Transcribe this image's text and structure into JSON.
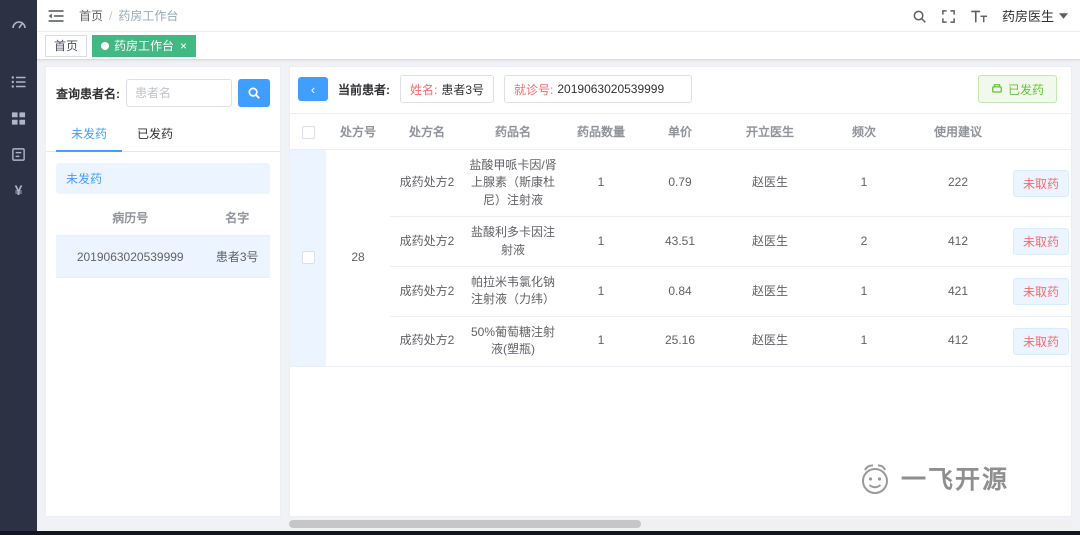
{
  "colors": {
    "accent_blue": "#409eff",
    "accent_green": "#42b983",
    "danger_red": "#f56c6c",
    "sidebar_bg": "#2c3244",
    "row_highlight": "#ecf5ff"
  },
  "sidebar": {
    "icons": [
      "dashboard-icon",
      "workbench-icon",
      "grid-icon",
      "form-icon",
      "money-icon"
    ]
  },
  "header": {
    "breadcrumb": {
      "home": "首页",
      "separator": "/",
      "current": "药房工作台"
    },
    "user_name": "药房医生"
  },
  "tags": {
    "home": "首页",
    "active": "药房工作台",
    "close": "×"
  },
  "left_panel": {
    "search_label": "查询患者名:",
    "search_placeholder": "患者名",
    "tab_undispensed": "未发药",
    "tab_dispensed": "已发药",
    "banner": "未发药",
    "columns": {
      "record_no": "病历号",
      "name": "名字"
    },
    "patients": [
      {
        "record_no": "2019063020539999",
        "name": "患者3号"
      }
    ]
  },
  "right_panel": {
    "back_button": "‹",
    "current_patient_label": "当前患者:",
    "name_label": "姓名:",
    "name_value": "患者3号",
    "visit_label": "就诊号:",
    "visit_value": "2019063020539999",
    "dispense_button": "已发药",
    "table": {
      "headers": [
        "处方号",
        "处方名",
        "药品名",
        "药品数量",
        "单价",
        "开立医生",
        "频次",
        "使用建议",
        ""
      ],
      "prescription_no": "28",
      "rows": [
        {
          "rx_name": "成药处方2",
          "drug": "盐酸甲哌卡因/肾上腺素（斯康杜尼）注射液",
          "qty": "1",
          "price": "0.79",
          "doctor": "赵医生",
          "freq": "1",
          "advice": "222",
          "action": "未取药"
        },
        {
          "rx_name": "成药处方2",
          "drug": "盐酸利多卡因注射液",
          "qty": "1",
          "price": "43.51",
          "doctor": "赵医生",
          "freq": "2",
          "advice": "412",
          "action": "未取药"
        },
        {
          "rx_name": "成药处方2",
          "drug": "帕拉米韦氯化钠注射液（力纬）",
          "qty": "1",
          "price": "0.84",
          "doctor": "赵医生",
          "freq": "1",
          "advice": "421",
          "action": "未取药"
        },
        {
          "rx_name": "成药处方2",
          "drug": "50%葡萄糖注射液(塑瓶)",
          "qty": "1",
          "price": "25.16",
          "doctor": "赵医生",
          "freq": "1",
          "advice": "412",
          "action": "未取药"
        }
      ]
    }
  },
  "watermark": "一飞开源"
}
